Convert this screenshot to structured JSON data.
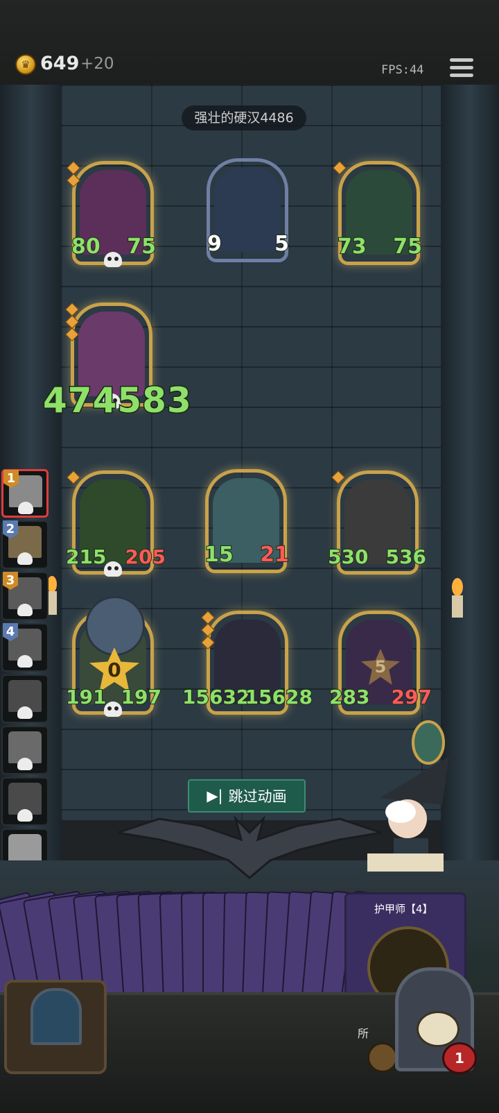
{
  "topbar": {
    "gold": "649",
    "gold_gain": "+20",
    "fps": "FPS:44"
  },
  "opponent_name": "强壮的硬汉4486",
  "enemy_board": [
    {
      "atk": "80",
      "hp": "75",
      "art": "#5b2f5a",
      "frame": "gold"
    },
    {
      "atk": "9",
      "hp": "5",
      "art": "#2c3a52",
      "frame": "blue"
    },
    {
      "atk": "73",
      "hp": "75",
      "art": "#2c4a3a",
      "frame": "gold"
    }
  ],
  "damage_popup": "474583",
  "player_board": [
    {
      "atk": "215",
      "hp": "205",
      "art": "#2f4a2a",
      "hp_color": "red"
    },
    {
      "atk": "15",
      "hp": "21",
      "art": "#3b5f62",
      "hp_color": "green"
    },
    {
      "atk": "530",
      "hp": "536",
      "art": "#3b3b3b",
      "hp_color": "green"
    },
    {
      "atk": "191",
      "hp": "197",
      "art": "#3a4a3a",
      "hp_color": "green",
      "badge": "0"
    },
    {
      "atk": "15632",
      "hp": "15628",
      "art": "#2a2a3a",
      "hp_color": "green"
    },
    {
      "atk": "283",
      "hp": "297",
      "art": "#3a2a4a",
      "hp_color": "red",
      "badge": "5"
    }
  ],
  "sidebar_ranks": [
    "1",
    "2",
    "3",
    "4"
  ],
  "skip_button": "跳过动画",
  "hand_card_name": "护甲师【4】",
  "hand_card_text_fragment": "所",
  "lives": "1",
  "colors": {
    "gold_frame": "#c9a24a",
    "green_stat": "#8ee06a",
    "red_stat": "#ff5a5a",
    "skip_bg": "#1f5b4a"
  }
}
